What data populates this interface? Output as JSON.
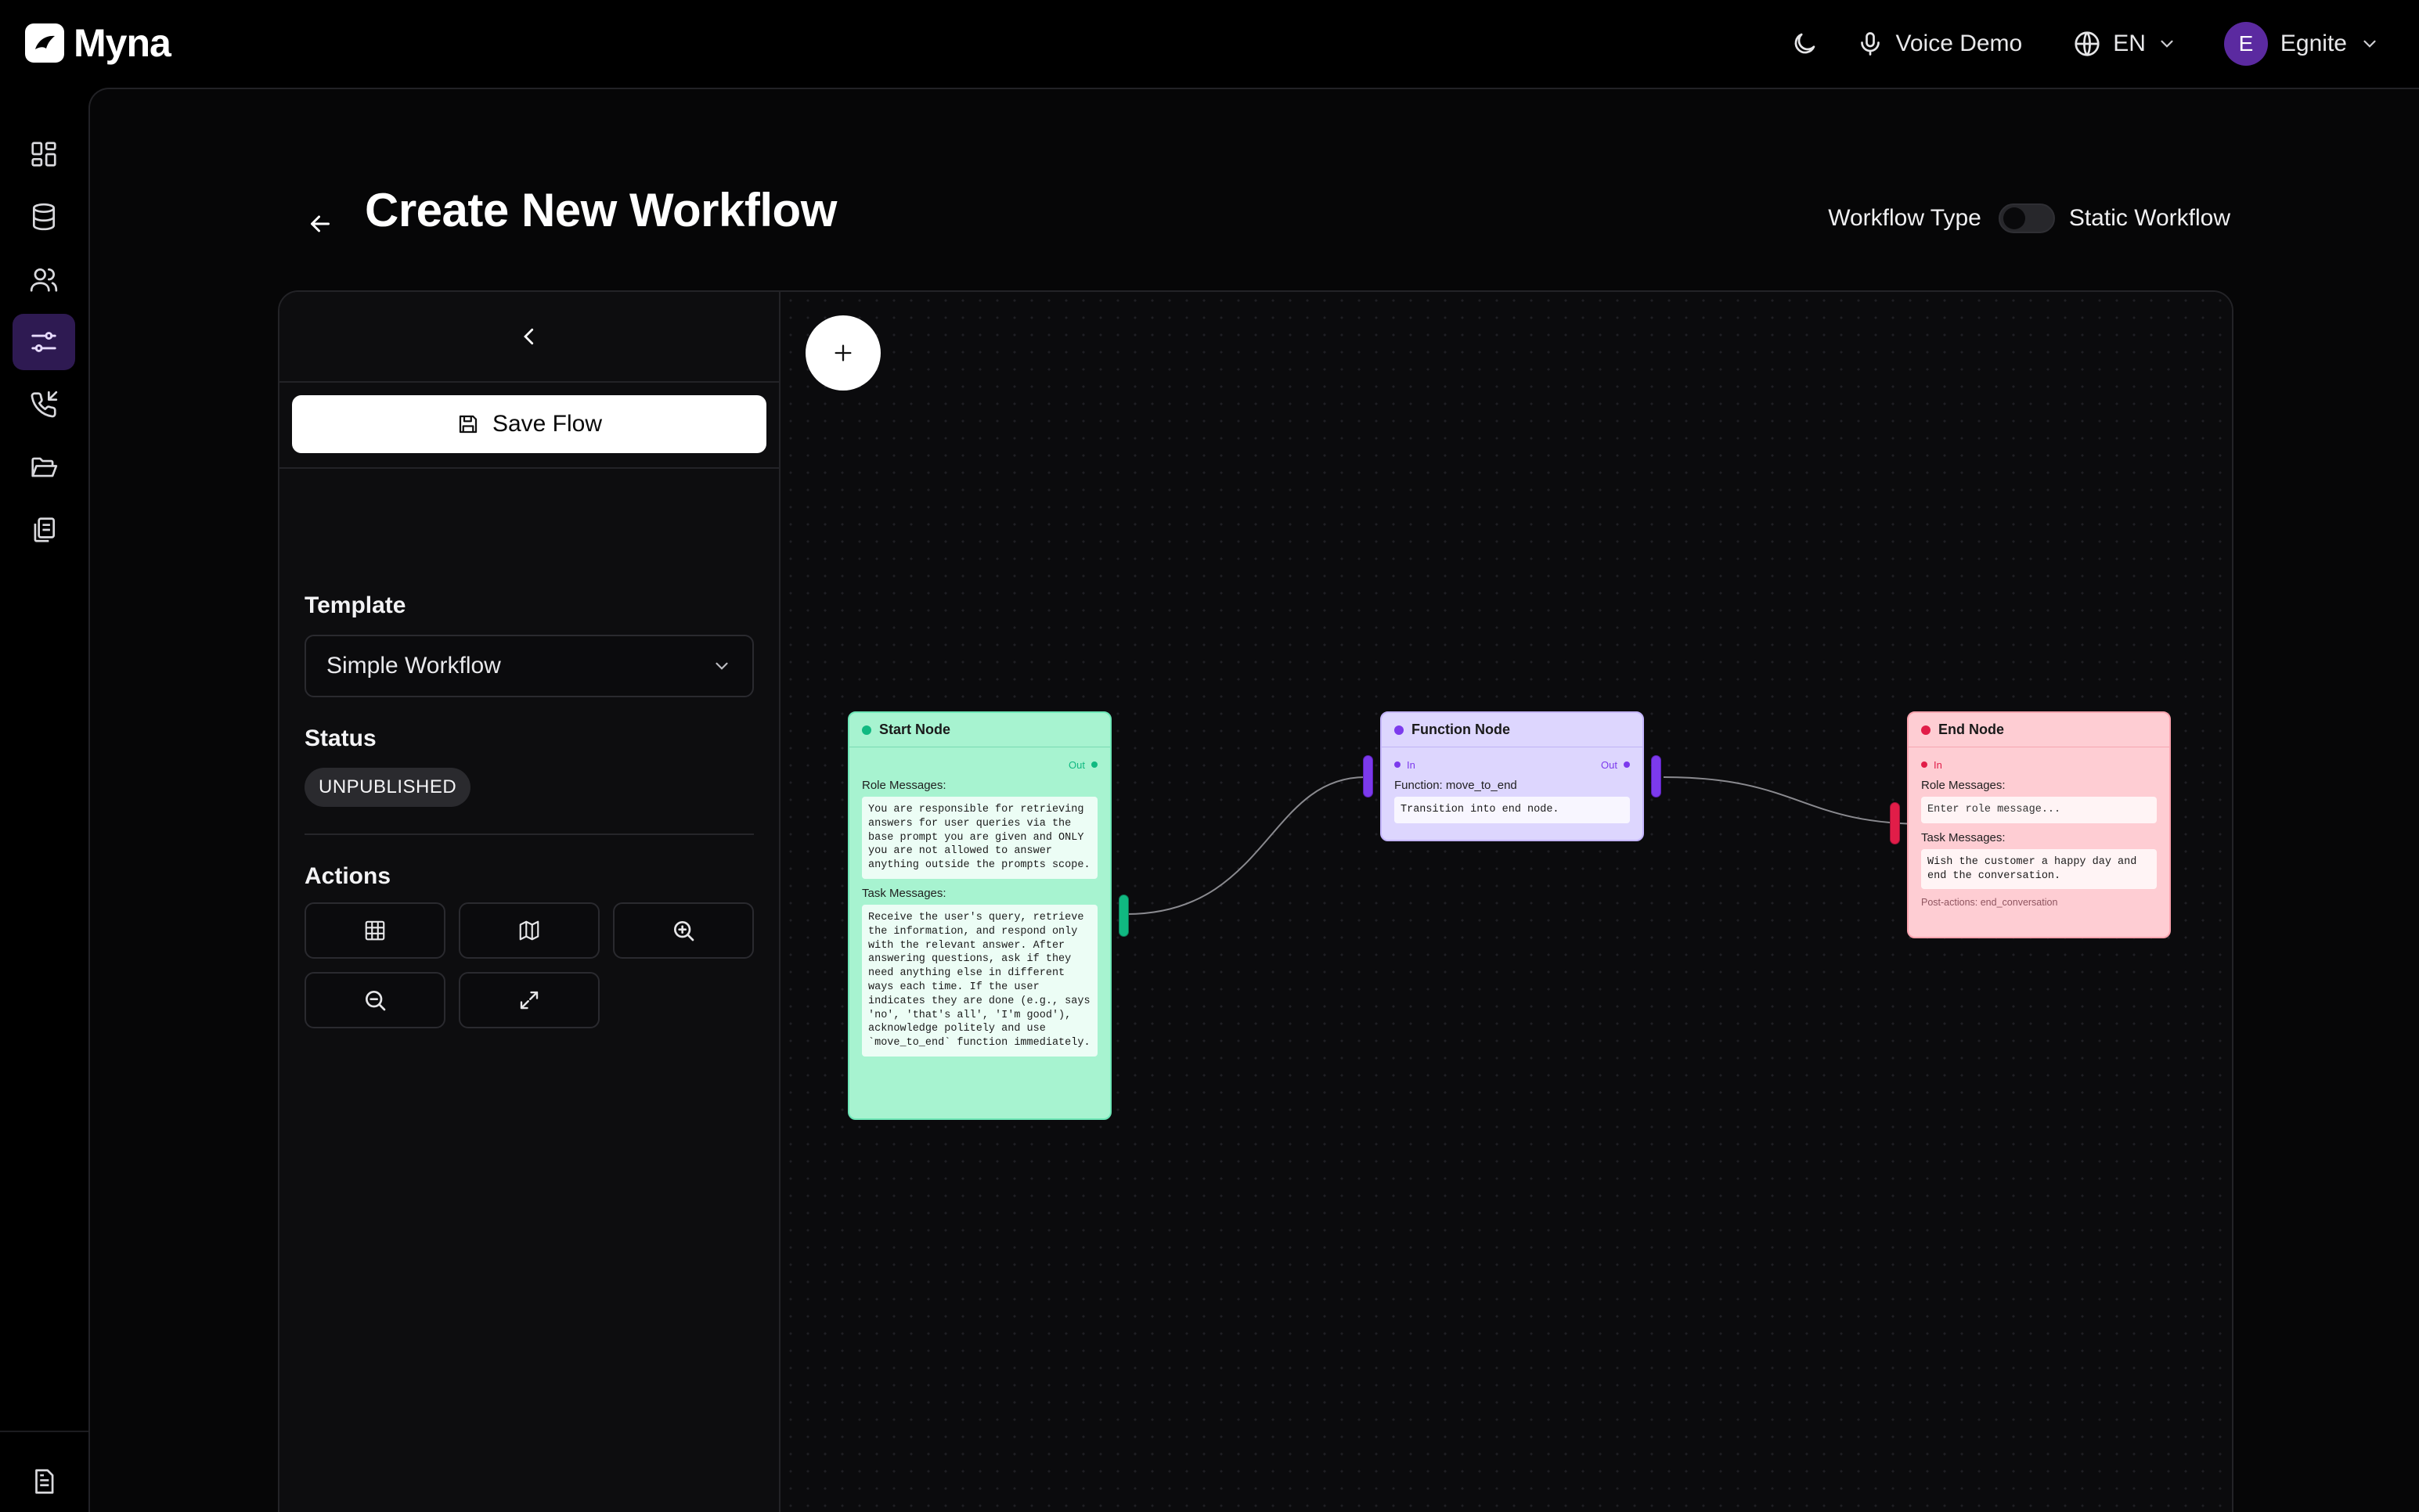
{
  "app": {
    "name": "Myna"
  },
  "header": {
    "voice_label": "Voice Demo",
    "language": "EN",
    "user_initial": "E",
    "user_name": "Egnite"
  },
  "rail": {
    "items": [
      {
        "icon": "dashboard-icon"
      },
      {
        "icon": "database-icon"
      },
      {
        "icon": "users-icon"
      },
      {
        "icon": "workflow-settings-icon",
        "active": true
      },
      {
        "icon": "phone-incoming-icon"
      },
      {
        "icon": "folder-open-icon"
      },
      {
        "icon": "copy-files-icon"
      }
    ],
    "bottom_items": [
      {
        "icon": "document-icon"
      },
      {
        "icon": "notebook-icon"
      }
    ]
  },
  "page": {
    "title": "Create New Workflow",
    "workflow_type_label": "Workflow Type",
    "workflow_type_value": "Static Workflow"
  },
  "panel": {
    "save_label": "Save Flow",
    "template_label": "Template",
    "template_value": "Simple Workflow",
    "status_label": "Status",
    "status_value": "UNPUBLISHED",
    "actions_label": "Actions"
  },
  "nodes": {
    "start": {
      "title": "Start Node",
      "out_label": "Out",
      "role_label": "Role Messages:",
      "role_text": "You are responsible for retrieving answers for user queries via the base prompt you are given and ONLY you are not allowed to answer anything outside the prompts scope.",
      "task_label": "Task Messages:",
      "task_text": "Receive the user's query, retrieve the information, and respond only with the relevant answer. After answering questions, ask if they need anything else in different ways each time. If the user indicates they are done (e.g., says 'no', 'that's all', 'I'm good'), acknowledge politely and use `move_to_end` function immediately."
    },
    "function": {
      "title": "Function Node",
      "in_label": "In",
      "out_label": "Out",
      "function_label": "Function: move_to_end",
      "description": "Transition into end node."
    },
    "end": {
      "title": "End Node",
      "in_label": "In",
      "role_label": "Role Messages:",
      "role_placeholder": "Enter role message...",
      "task_label": "Task Messages:",
      "task_text": "Wish the customer a happy day and end the conversation.",
      "post_actions": "Post-actions: end_conversation"
    }
  },
  "colors": {
    "accent": "#2e1a52",
    "start_bg": "#a7f3d0",
    "start_accent": "#10b981",
    "function_bg": "#ddd6fe",
    "function_accent": "#7c3aed",
    "end_bg": "#fecdd3",
    "end_accent": "#e11d48"
  }
}
